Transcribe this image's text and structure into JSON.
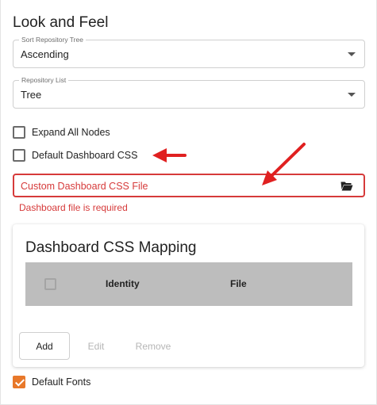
{
  "section": {
    "title": "Look and Feel"
  },
  "sort_repository_tree": {
    "legend": "Sort Repository Tree",
    "value": "Ascending"
  },
  "repository_list": {
    "legend": "Repository List",
    "value": "Tree"
  },
  "checkboxes": {
    "expand_all_nodes": {
      "label": "Expand All Nodes",
      "checked": false
    },
    "default_dashboard_css": {
      "label": "Default Dashboard CSS",
      "checked": false
    },
    "default_fonts": {
      "label": "Default Fonts",
      "checked": true
    }
  },
  "custom_css_field": {
    "placeholder": "Custom Dashboard CSS File",
    "error": "Dashboard file is required",
    "icon": "folder-open-icon"
  },
  "mapping": {
    "title": "Dashboard CSS Mapping",
    "columns": [
      "Identity",
      "File"
    ],
    "rows": [],
    "buttons": {
      "add": "Add",
      "edit": "Edit",
      "remove": "Remove"
    }
  },
  "colors": {
    "accent": "#e8782a",
    "error": "#d63a3a",
    "annotation_arrow": "#e02020",
    "table_header": "#bdbdbd"
  }
}
